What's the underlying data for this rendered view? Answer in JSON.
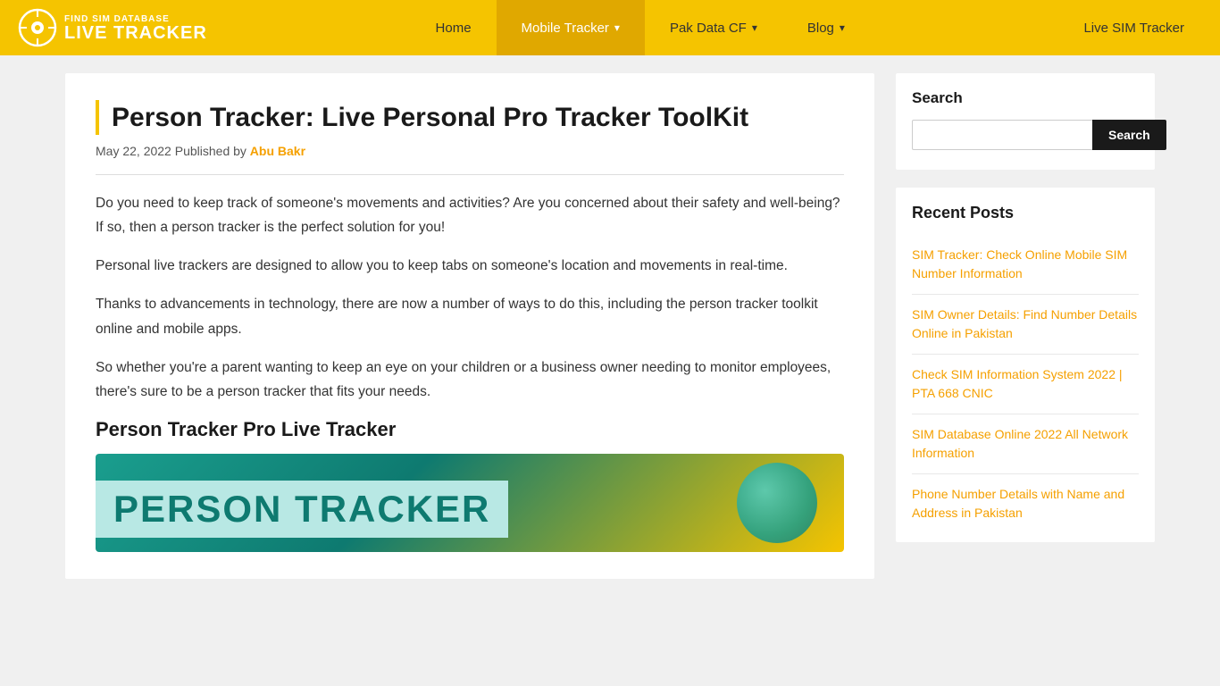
{
  "header": {
    "logo_top": "FIND SIM DATABASE",
    "logo_bottom": "LIVE TRACKER",
    "nav_items": [
      {
        "label": "Home",
        "active": false,
        "has_dropdown": false
      },
      {
        "label": "Mobile Tracker",
        "active": true,
        "has_dropdown": true
      },
      {
        "label": "Pak Data CF",
        "active": false,
        "has_dropdown": true
      },
      {
        "label": "Blog",
        "active": false,
        "has_dropdown": true
      }
    ],
    "live_sim_label": "Live SIM Tracker"
  },
  "article": {
    "title": "Person Tracker: Live Personal Pro Tracker ToolKit",
    "meta_date": "May 22, 2022",
    "meta_published": "Published by",
    "meta_author": "Abu Bakr",
    "paragraphs": [
      "Do you need to keep track of someone's movements and activities? Are you concerned about their safety and well-being? If so, then a person tracker is the perfect solution for you!",
      "Personal live trackers are designed to allow you to keep tabs on someone's location and movements in real-time.",
      "Thanks to advancements in technology, there are now a number of ways to do this, including the person tracker toolkit online and mobile apps.",
      "So whether you're a parent wanting to keep an eye on your children or a business owner needing to monitor employees, there's sure to be a person tracker that fits your needs."
    ],
    "section_heading": "Person Tracker Pro Live Tracker",
    "image_text": "PERSON TRACKER"
  },
  "sidebar": {
    "search": {
      "title": "Search",
      "placeholder": "",
      "button_label": "Search"
    },
    "recent_posts": {
      "title": "Recent Posts",
      "items": [
        {
          "label": "SIM Tracker: Check Online Mobile SIM Number Information"
        },
        {
          "label": "SIM Owner Details: Find Number Details Online in Pakistan"
        },
        {
          "label": "Check SIM Information System 2022 | PTA 668 CNIC"
        },
        {
          "label": "SIM Database Online 2022 All Network Information"
        },
        {
          "label": "Phone Number Details with Name and Address in Pakistan"
        }
      ]
    }
  }
}
